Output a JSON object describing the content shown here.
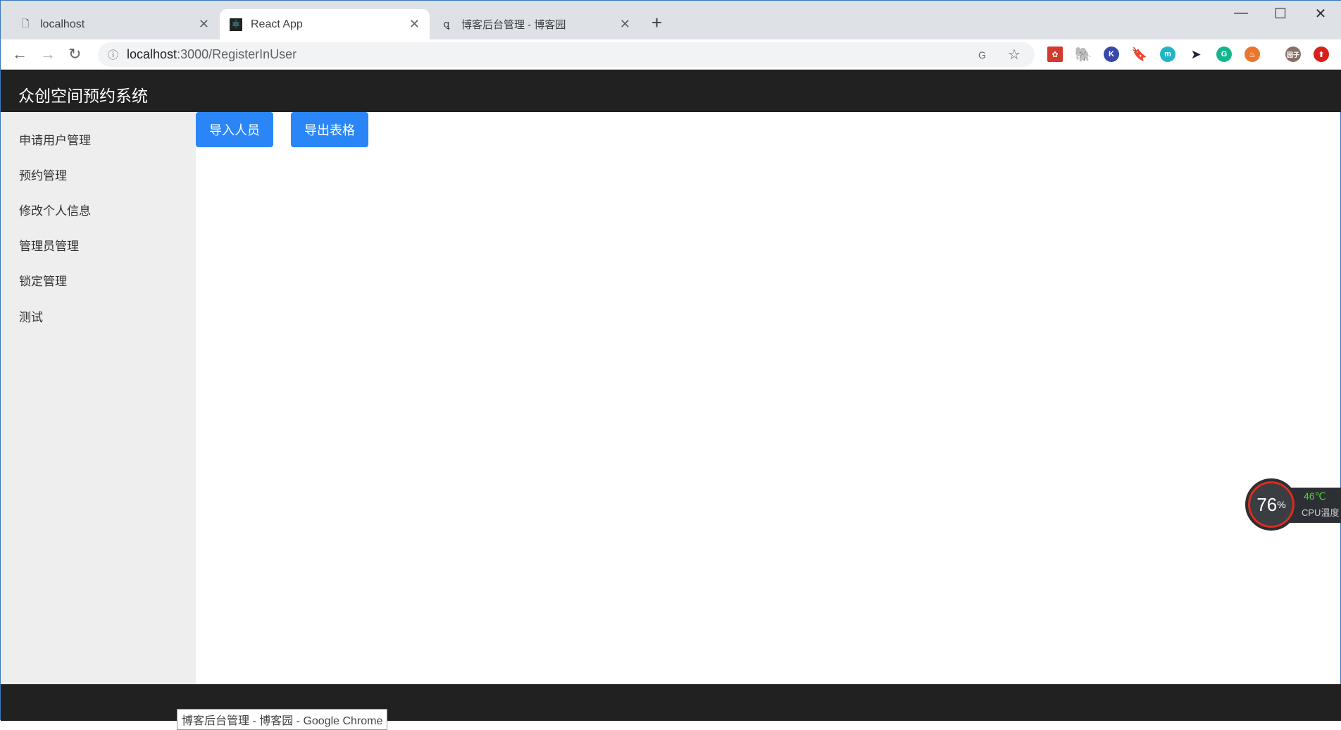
{
  "browser": {
    "tabs": [
      {
        "title": "localhost",
        "icon": "file-icon",
        "active": false
      },
      {
        "title": "React App",
        "icon": "react-icon",
        "active": true
      },
      {
        "title": "博客后台管理 - 博客园",
        "icon": "cnblogs-icon",
        "active": false
      }
    ],
    "url_host": "localhost",
    "url_path": ":3000/RegisterInUser",
    "extensions": [
      "google-translate-icon",
      "star-icon",
      "baidu-icon",
      "evernote-icon",
      "k-icon",
      "bookmark-icon",
      "m-icon",
      "cursor-icon",
      "grammarly-icon",
      "fire-icon",
      "profile-avatar",
      "upload-icon"
    ],
    "profile_label": "园子"
  },
  "app": {
    "title": "众创空间预约系统",
    "sidebar": [
      "申请用户管理",
      "预约管理",
      "修改个人信息",
      "管理员管理",
      "锁定管理",
      "测试"
    ],
    "buttons": {
      "import": "导入人员",
      "export": "导出表格"
    },
    "accent": "#2a86f7"
  },
  "cpu_widget": {
    "usage": "76",
    "unit": "%",
    "temp": "46℃",
    "label": "CPU温度"
  },
  "taskbar_tooltip": "博客后台管理 - 博客园 - Google Chrome"
}
